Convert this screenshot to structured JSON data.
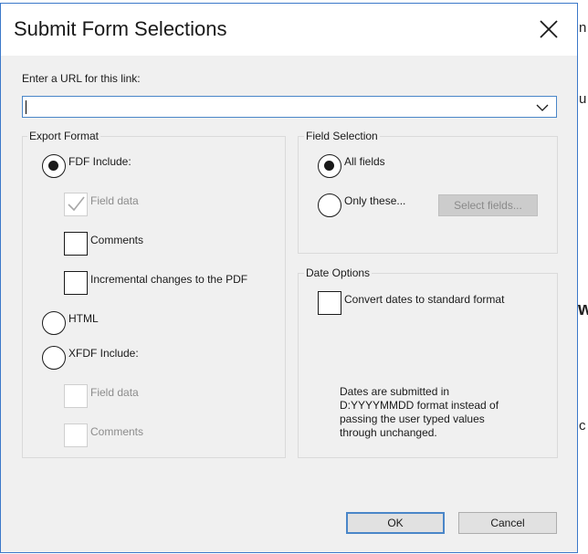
{
  "dialog": {
    "title": "Submit Form Selections",
    "url_label": "Enter a URL for this link:",
    "url_value": "",
    "export_format": {
      "legend": "Export Format",
      "fdf_label": "FDF  Include:",
      "fdf_field_data": "Field data",
      "fdf_comments": "Comments",
      "fdf_incremental": "Incremental changes to the PDF",
      "html_label": "HTML",
      "xfdf_label": "XFDF  Include:",
      "xfdf_field_data": "Field data",
      "xfdf_comments": "Comments",
      "selected": "FDF"
    },
    "field_selection": {
      "legend": "Field Selection",
      "all_fields": "All fields",
      "only_these": "Only these...",
      "select_fields_button": "Select fields...",
      "selected": "All fields"
    },
    "date_options": {
      "legend": "Date Options",
      "convert_dates": "Convert dates to standard format",
      "convert_dates_checked": false,
      "note": "Dates are submitted in D:YYYYMMDD format instead of passing the user typed values through unchanged."
    },
    "ok_button": "OK",
    "cancel_button": "Cancel"
  },
  "colors": {
    "accent": "#4a86c8",
    "dialog_bg": "#f0f0f0"
  }
}
